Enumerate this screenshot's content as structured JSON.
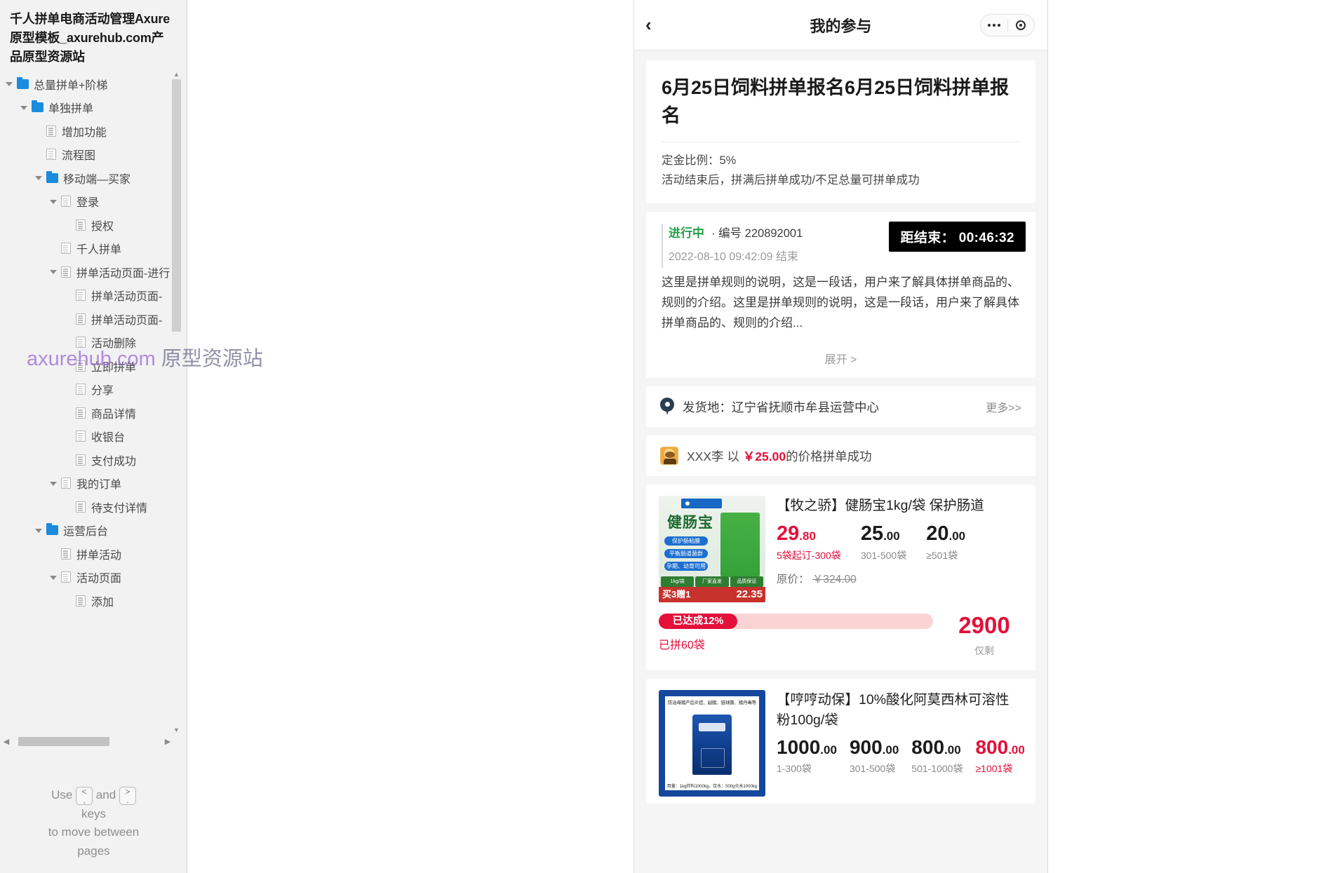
{
  "sidebar": {
    "site_title": "千人拼单电商活动管理Axure原型模板_axurehub.com产品原型资源站",
    "tree": [
      {
        "label": "总量拼单+阶梯",
        "type": "folder",
        "depth": 0,
        "caret": "open"
      },
      {
        "label": "单独拼单",
        "type": "folder",
        "depth": 1,
        "caret": "open"
      },
      {
        "label": "增加功能",
        "type": "page",
        "depth": 2,
        "caret": "none"
      },
      {
        "label": "流程图",
        "type": "page",
        "depth": 2,
        "caret": "none"
      },
      {
        "label": "移动端—买家",
        "type": "folder",
        "depth": 2,
        "caret": "open"
      },
      {
        "label": "登录",
        "type": "page",
        "depth": 3,
        "caret": "open"
      },
      {
        "label": "授权",
        "type": "page",
        "depth": 4,
        "caret": "none"
      },
      {
        "label": "千人拼单",
        "type": "page",
        "depth": 3,
        "caret": "none"
      },
      {
        "label": "拼单活动页面-进行",
        "type": "page",
        "depth": 3,
        "caret": "open"
      },
      {
        "label": "拼单活动页面-",
        "type": "page",
        "depth": 4,
        "caret": "none"
      },
      {
        "label": "拼单活动页面-",
        "type": "page",
        "depth": 4,
        "caret": "none"
      },
      {
        "label": "活动删除",
        "type": "page",
        "depth": 4,
        "caret": "none"
      },
      {
        "label": "立即拼单",
        "type": "page",
        "depth": 4,
        "caret": "none"
      },
      {
        "label": "分享",
        "type": "page",
        "depth": 4,
        "caret": "none"
      },
      {
        "label": "商品详情",
        "type": "page",
        "depth": 4,
        "caret": "none"
      },
      {
        "label": "收银台",
        "type": "page",
        "depth": 4,
        "caret": "none"
      },
      {
        "label": "支付成功",
        "type": "page",
        "depth": 4,
        "caret": "none"
      },
      {
        "label": "我的订单",
        "type": "page",
        "depth": 3,
        "caret": "open"
      },
      {
        "label": "待支付详情",
        "type": "page",
        "depth": 4,
        "caret": "none"
      },
      {
        "label": "运营后台",
        "type": "folder",
        "depth": 2,
        "caret": "open"
      },
      {
        "label": "拼单活动",
        "type": "page",
        "depth": 3,
        "caret": "none"
      },
      {
        "label": "活动页面",
        "type": "page",
        "depth": 3,
        "caret": "open"
      },
      {
        "label": "添加",
        "type": "page",
        "depth": 4,
        "caret": "none"
      }
    ],
    "help": {
      "use": "Use",
      "key_prev_top": "<",
      "key_prev_bottom": ",",
      "and": "and",
      "key_next_top": ">",
      "key_next_bottom": ".",
      "keys": "keys",
      "line2": "to move between",
      "line3": "pages"
    }
  },
  "watermark": {
    "text1": "axurehub.com",
    "text2": "原型资源站"
  },
  "phone": {
    "nav": {
      "back_icon": "chevron-left-icon",
      "title": "我的参与",
      "capsule_more_icon": "more-dots-icon",
      "capsule_target_icon": "target-icon"
    },
    "activity": {
      "title": "6月25日饲料拼单报名6月25日饲料拼单报名",
      "deposit_label": "定金比例：5%",
      "rule_summary": "活动结束后，拼满后拼单成功/不足总量可拼单成功"
    },
    "status": {
      "state": "进行中",
      "code": "· 编号 220892001",
      "countdown_label": "距结束：",
      "countdown_value": "00:46:32",
      "end_time": "2022-08-10 09:42:09 结束",
      "rule_text": "这里是拼单规则的说明，这是一段话，用户来了解具体拼单商品的、规则的介绍。这里是拼单规则的说明，这是一段话，用户来了解具体拼单商品的、规则的介绍...",
      "expand_label": "展开 >"
    },
    "shipping": {
      "icon": "location-pin-icon",
      "text": "发货地：辽宁省抚顺市牟县运营中心",
      "more_label": "更多>>"
    },
    "winner": {
      "avatar_icon": "user-avatar-icon",
      "name": "XXX李",
      "prefix": "以",
      "currency": "￥",
      "price": "25.00",
      "suffix": "的价格拼单成功"
    },
    "products": [
      {
        "name": "【牧之骄】健肠宝1kg/袋  保护肠道",
        "thumb_title": "健肠宝",
        "thumb_tags": [
          "保护肠粘膜",
          "平衡肠道菌群",
          "孕期、幼育可用"
        ],
        "thumb_foot": [
          "1kg/袋",
          "厂家直发",
          "品质保证"
        ],
        "thumb_promo": "买3赠1",
        "thumb_promo_price": "22.35",
        "tiers": [
          {
            "yuan": "29",
            "cents": ".80",
            "range": "5袋起订-300袋",
            "hot": true
          },
          {
            "yuan": "25",
            "cents": ".00",
            "range": "301-500袋",
            "hot": false
          },
          {
            "yuan": "20",
            "cents": ".00",
            "range": "≥501袋",
            "hot": false
          }
        ],
        "orig_label": "原价：",
        "orig_price": "￥324.00",
        "progress_badge": "已达成12%",
        "progress_sub": "已拼60袋",
        "remain_value": "2900",
        "remain_label": "仅剩",
        "progress_percent": 12
      },
      {
        "name": "【哼哼动保】10%酸化阿莫西林可溶性粉100g/袋",
        "thumb_caption": "防治母猪产后炎症、副猪、链球菌、猪丹毒等",
        "thumb_foot": "用量：1kg拌料1000kg，饮水：500g兑水1000kg",
        "tiers": [
          {
            "yuan": "1000",
            "cents": ".00",
            "range": "1-300袋",
            "hot": false
          },
          {
            "yuan": "900",
            "cents": ".00",
            "range": "301-500袋",
            "hot": false
          },
          {
            "yuan": "800",
            "cents": ".00",
            "range": "501-1000袋",
            "hot": false
          },
          {
            "yuan": "800",
            "cents": ".00",
            "range": "≥1001袋",
            "hot": true
          }
        ]
      }
    ]
  },
  "colors": {
    "accent_red": "#e3103a",
    "accent_green": "#24a148",
    "folder_blue": "#1a8cde"
  }
}
